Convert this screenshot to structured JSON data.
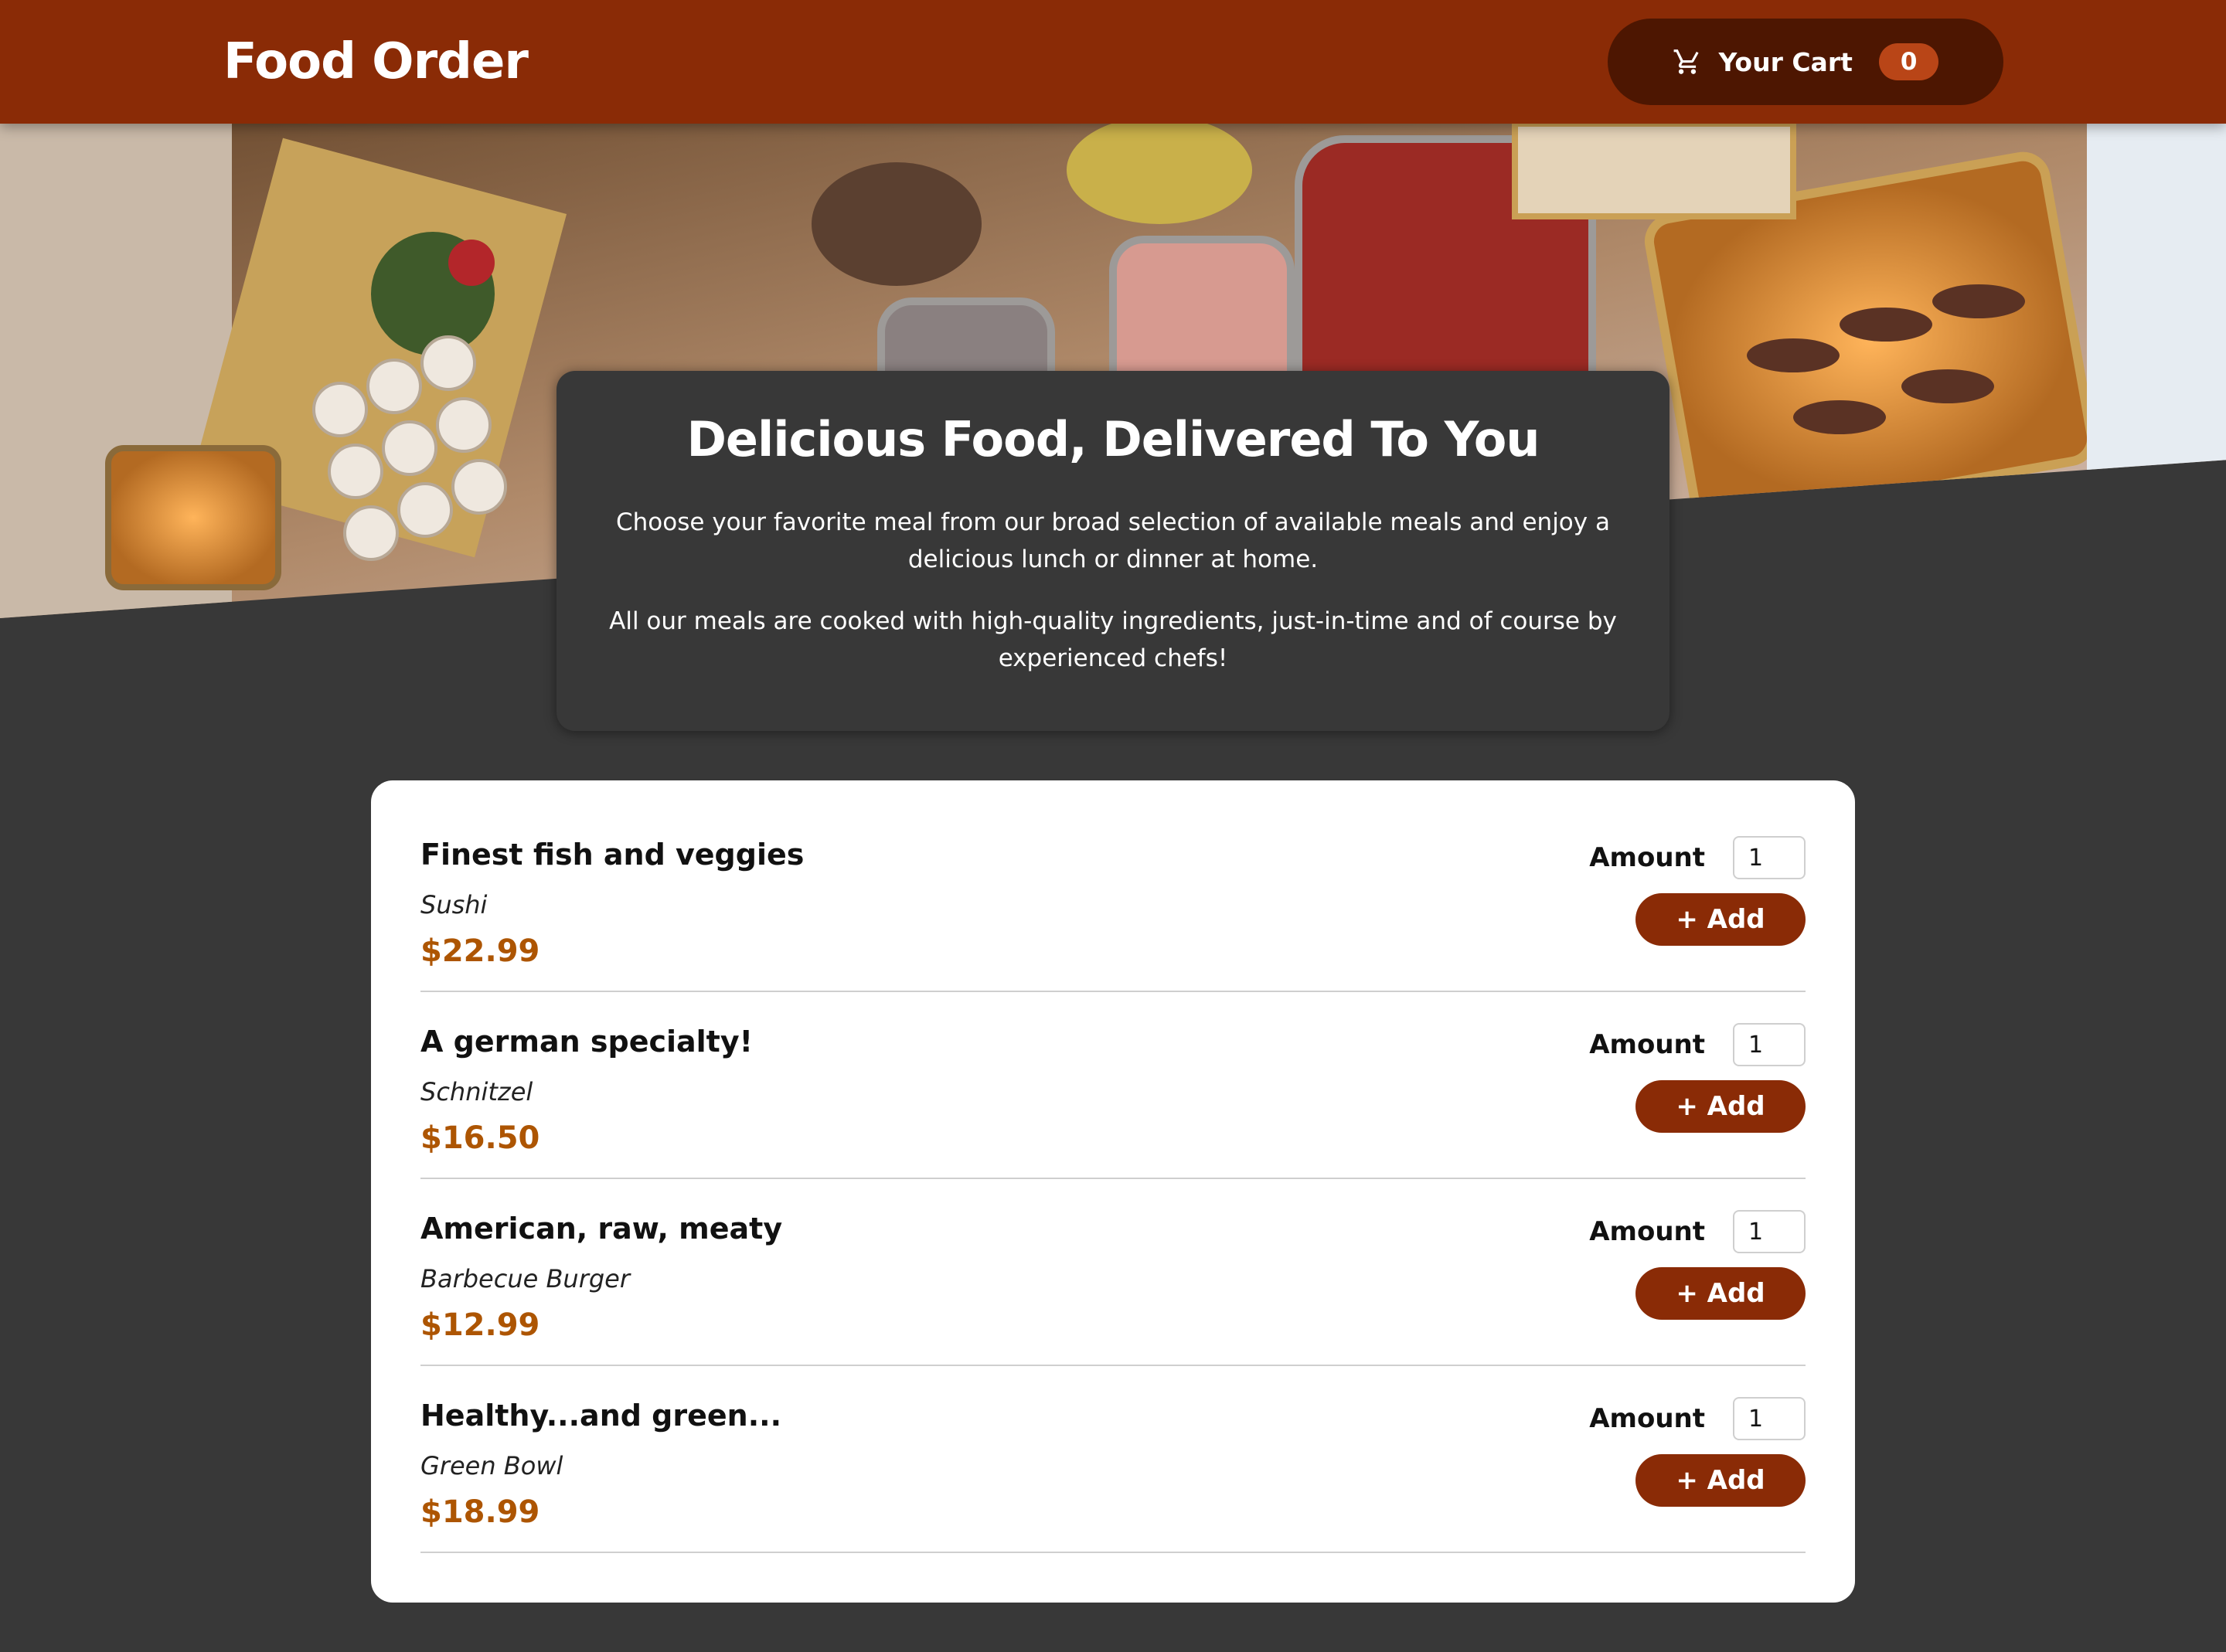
{
  "header": {
    "brand": "Food Order",
    "cart": {
      "icon": "cart-icon",
      "label": "Your Cart",
      "count": "0"
    }
  },
  "hero": {
    "image": "food-buffet-photo"
  },
  "summary": {
    "title": "Delicious Food, Delivered To You",
    "paragraph1": "Choose your favorite meal from our broad selection of available meals and enjoy a delicious lunch or dinner at home.",
    "paragraph2": "All our meals are cooked with high-quality ingredients, just-in-time and of course by experienced chefs!"
  },
  "meals": [
    {
      "name": "Finest fish and veggies",
      "description": "Sushi",
      "price": "$22.99",
      "amount_label": "Amount",
      "amount": "1",
      "add_label": "+ Add"
    },
    {
      "name": "A german specialty!",
      "description": "Schnitzel",
      "price": "$16.50",
      "amount_label": "Amount",
      "amount": "1",
      "add_label": "+ Add"
    },
    {
      "name": "American, raw, meaty",
      "description": "Barbecue Burger",
      "price": "$12.99",
      "amount_label": "Amount",
      "amount": "1",
      "add_label": "+ Add"
    },
    {
      "name": "Healthy...and green...",
      "description": "Green Bowl",
      "price": "$18.99",
      "amount_label": "Amount",
      "amount": "1",
      "add_label": "+ Add"
    }
  ],
  "colors": {
    "header": "#8a2b06",
    "cart_button": "#4d1601",
    "badge": "#b94517",
    "background": "#383838",
    "price": "#ad5502"
  }
}
